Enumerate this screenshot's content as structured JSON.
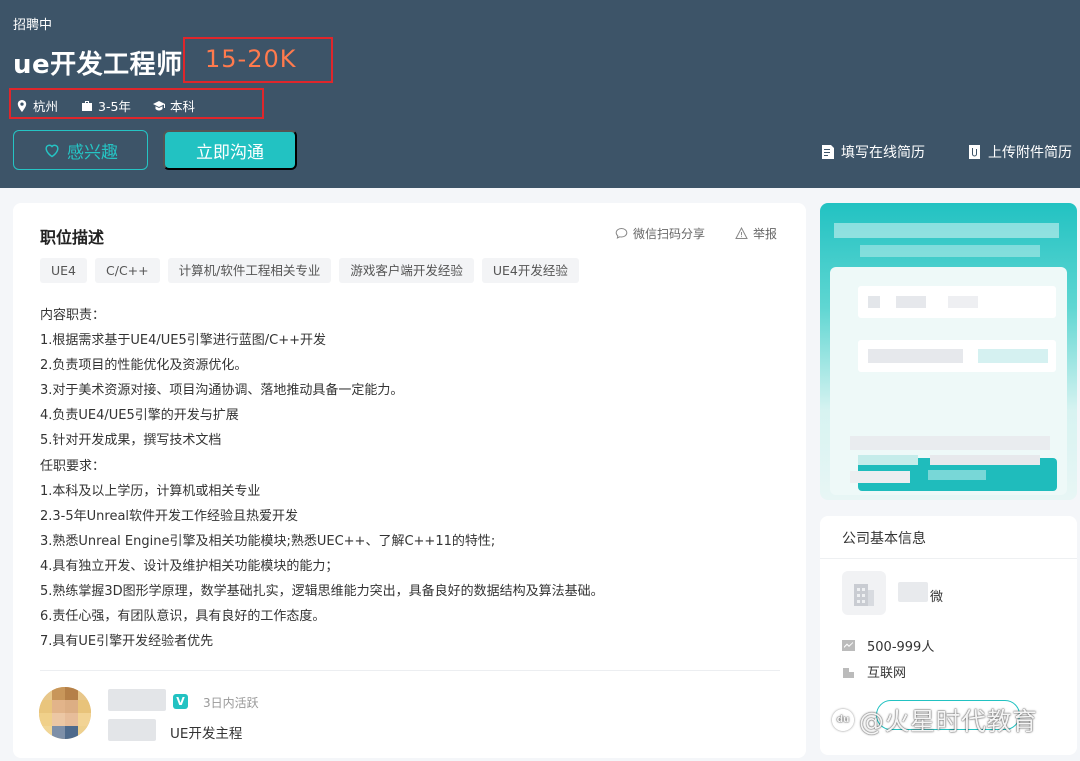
{
  "header": {
    "status": "招聘中",
    "title": "ue开发工程师",
    "salary": "15-20K",
    "meta": {
      "location": "杭州",
      "experience": "3-5年",
      "education": "本科"
    },
    "interest_label": "感兴趣",
    "chat_label": "立即沟通",
    "online_resume_label": "填写在线简历",
    "upload_resume_label": "上传附件简历",
    "accent_color": "#22c2c2",
    "salary_color": "#ff7a4d"
  },
  "job": {
    "section_title": "职位描述",
    "share_label": "微信扫码分享",
    "report_label": "举报",
    "tags": [
      "UE4",
      "C/C++",
      "计算机/软件工程相关专业",
      "游戏客户端开发经验",
      "UE4开发经验"
    ],
    "description": [
      "内容职责：",
      "1.根据需求基于UE4/UE5引擎进行蓝图/C++开发",
      "2.负责项目的性能优化及资源优化。",
      "3.对于美术资源对接、项目沟通协调、落地推动具备一定能力。",
      "4.负责UE4/UE5引擎的开发与扩展",
      "5.针对开发成果，撰写技术文档",
      "任职要求：",
      "1.本科及以上学历，计算机或相关专业",
      "2.3-5年Unreal软件开发工作经验且热爱开发",
      "3.熟悉Unreal Engine引擎及相关功能模块;熟悉UEC++、了解C++11的特性;",
      "4.具有独立开发、设计及维护相关功能模块的能力；",
      "5.熟练掌握3D图形学原理，数学基础扎实，逻辑思维能力突出，具备良好的数据结构及算法基础。",
      "6.责任心强，有团队意识，具有良好的工作态度。",
      "7.具有UE引擎开发经验者优先"
    ]
  },
  "recruiter": {
    "verified_badge": "V",
    "active_status": "3日内活跃",
    "role": "UE开发主程"
  },
  "company": {
    "section_title": "公司基本信息",
    "name_suffix": "微",
    "size": "500-999人",
    "industry": "互联网"
  },
  "watermark": {
    "logo": "du",
    "text": "@火星时代教育"
  }
}
